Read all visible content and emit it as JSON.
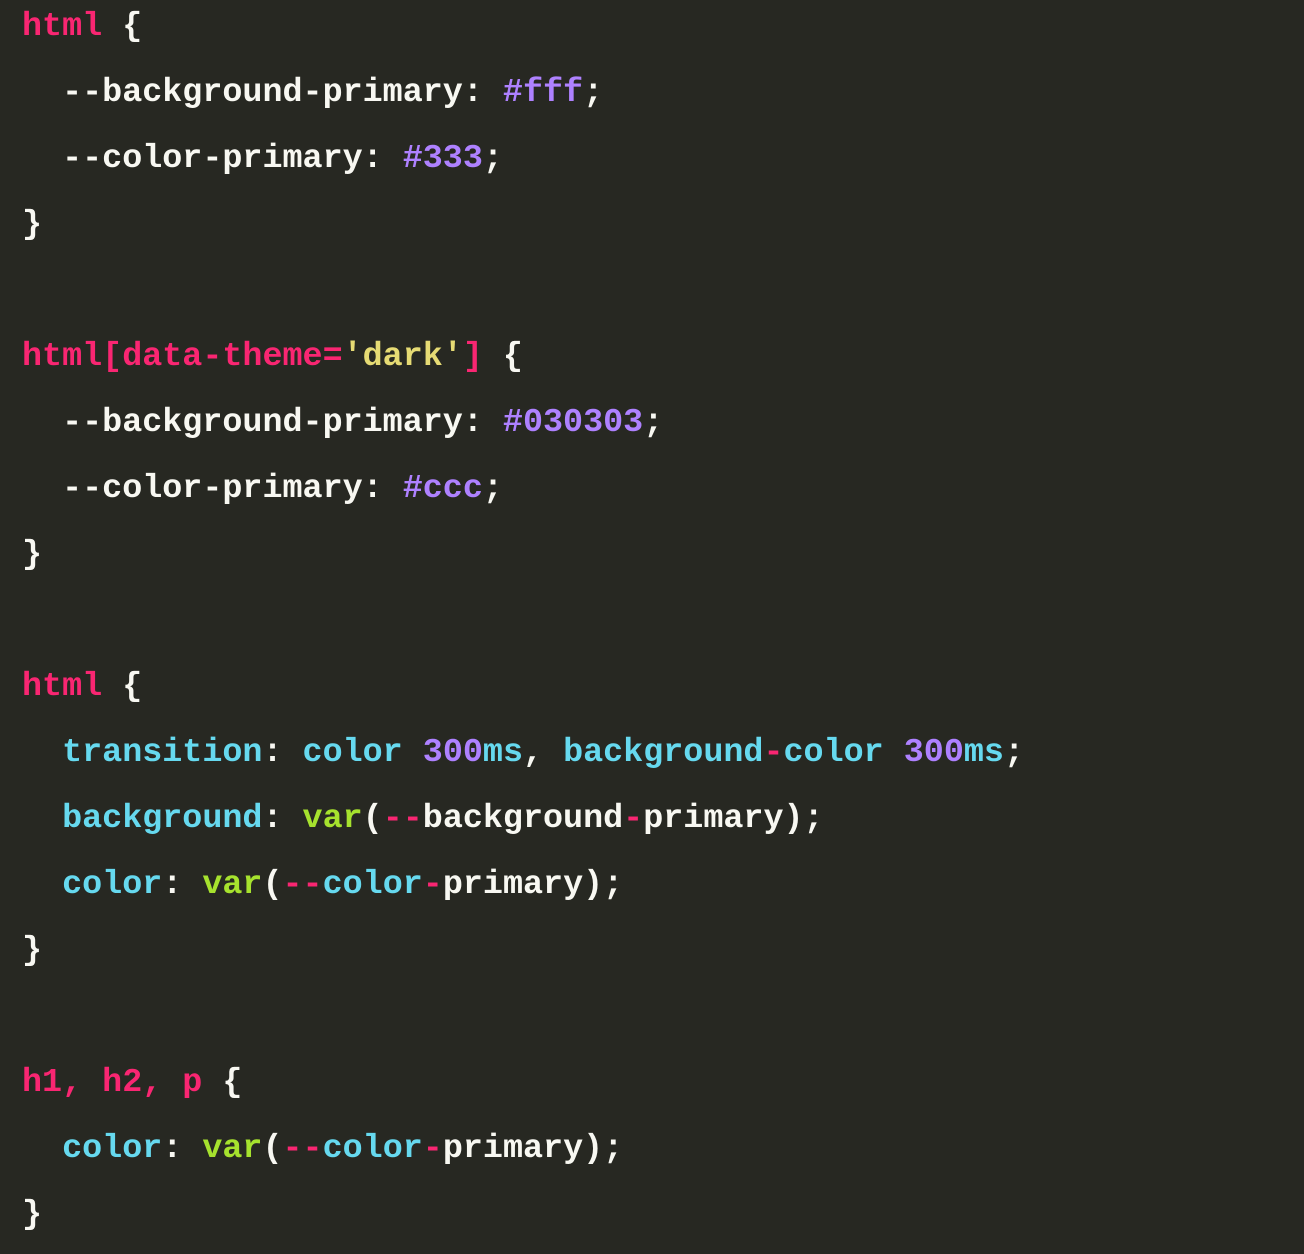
{
  "theme": {
    "background": "#272822",
    "colors": {
      "selector": "#f92672",
      "property": "#66d9ef",
      "number": "#ae81ff",
      "function": "#a6e22e",
      "string": "#e6db74",
      "text": "#f8f8f2"
    }
  },
  "code": {
    "language": "css",
    "lines": [
      [
        {
          "t": "html",
          "k": "selector"
        },
        {
          "t": " {",
          "k": "punct"
        }
      ],
      [
        {
          "t": "  --background-primary",
          "k": "property-custom"
        },
        {
          "t": ": ",
          "k": "punct"
        },
        {
          "t": "#fff",
          "k": "number"
        },
        {
          "t": ";",
          "k": "punct"
        }
      ],
      [
        {
          "t": "  --color-primary",
          "k": "property-custom"
        },
        {
          "t": ": ",
          "k": "punct"
        },
        {
          "t": "#333",
          "k": "number"
        },
        {
          "t": ";",
          "k": "punct"
        }
      ],
      [
        {
          "t": "}",
          "k": "punct"
        }
      ],
      [],
      [
        {
          "t": "html[data-theme=",
          "k": "selector"
        },
        {
          "t": "'dark'",
          "k": "string"
        },
        {
          "t": "]",
          "k": "selector"
        },
        {
          "t": " {",
          "k": "punct"
        }
      ],
      [
        {
          "t": "  --background-primary",
          "k": "property-custom"
        },
        {
          "t": ": ",
          "k": "punct"
        },
        {
          "t": "#030303",
          "k": "number"
        },
        {
          "t": ";",
          "k": "punct"
        }
      ],
      [
        {
          "t": "  --color-primary",
          "k": "property-custom"
        },
        {
          "t": ": ",
          "k": "punct"
        },
        {
          "t": "#ccc",
          "k": "number"
        },
        {
          "t": ";",
          "k": "punct"
        }
      ],
      [
        {
          "t": "}",
          "k": "punct"
        }
      ],
      [],
      [
        {
          "t": "html",
          "k": "selector"
        },
        {
          "t": " {",
          "k": "punct"
        }
      ],
      [
        {
          "t": "  transition",
          "k": "property"
        },
        {
          "t": ": ",
          "k": "punct"
        },
        {
          "t": "color",
          "k": "keyword"
        },
        {
          "t": " ",
          "k": "plain"
        },
        {
          "t": "300",
          "k": "number"
        },
        {
          "t": "ms",
          "k": "keyword"
        },
        {
          "t": ", ",
          "k": "punct"
        },
        {
          "t": "background",
          "k": "keyword"
        },
        {
          "t": "-",
          "k": "operator"
        },
        {
          "t": "color",
          "k": "keyword"
        },
        {
          "t": " ",
          "k": "plain"
        },
        {
          "t": "300",
          "k": "number"
        },
        {
          "t": "ms",
          "k": "keyword"
        },
        {
          "t": ";",
          "k": "punct"
        }
      ],
      [
        {
          "t": "  background",
          "k": "property"
        },
        {
          "t": ": ",
          "k": "punct"
        },
        {
          "t": "var",
          "k": "function"
        },
        {
          "t": "(",
          "k": "punct"
        },
        {
          "t": "--",
          "k": "operator"
        },
        {
          "t": "background",
          "k": "plain"
        },
        {
          "t": "-",
          "k": "operator"
        },
        {
          "t": "primary",
          "k": "plain"
        },
        {
          "t": ");",
          "k": "punct"
        }
      ],
      [
        {
          "t": "  color",
          "k": "property"
        },
        {
          "t": ": ",
          "k": "punct"
        },
        {
          "t": "var",
          "k": "function"
        },
        {
          "t": "(",
          "k": "punct"
        },
        {
          "t": "--",
          "k": "operator"
        },
        {
          "t": "color",
          "k": "keyword"
        },
        {
          "t": "-",
          "k": "operator"
        },
        {
          "t": "primary",
          "k": "plain"
        },
        {
          "t": ");",
          "k": "punct"
        }
      ],
      [
        {
          "t": "}",
          "k": "punct"
        }
      ],
      [],
      [
        {
          "t": "h1, h2, p",
          "k": "selector"
        },
        {
          "t": " {",
          "k": "punct"
        }
      ],
      [
        {
          "t": "  color",
          "k": "property"
        },
        {
          "t": ": ",
          "k": "punct"
        },
        {
          "t": "var",
          "k": "function"
        },
        {
          "t": "(",
          "k": "punct"
        },
        {
          "t": "--",
          "k": "operator"
        },
        {
          "t": "color",
          "k": "keyword"
        },
        {
          "t": "-",
          "k": "operator"
        },
        {
          "t": "primary",
          "k": "plain"
        },
        {
          "t": ");",
          "k": "punct"
        }
      ],
      [
        {
          "t": "}",
          "k": "punct"
        }
      ]
    ]
  }
}
